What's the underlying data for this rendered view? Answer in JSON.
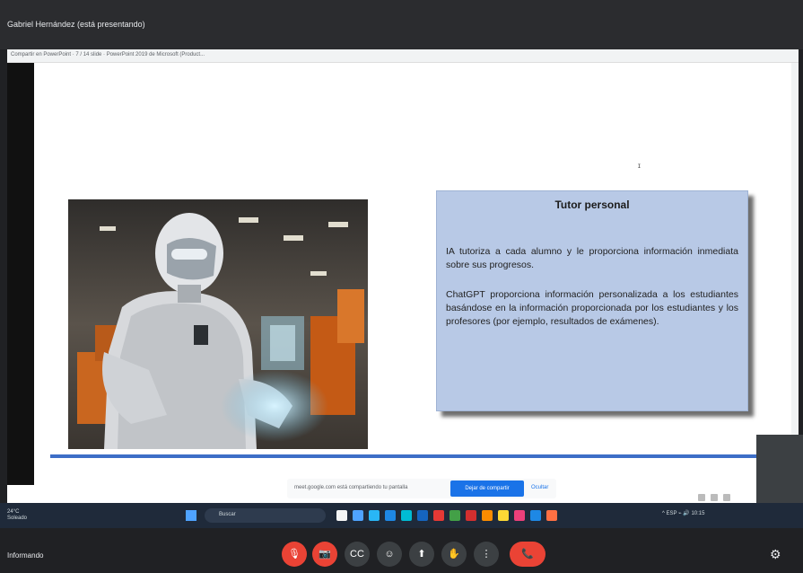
{
  "window": {
    "title": "Gabriel Hernández (está presentando)"
  },
  "browser": {
    "tab_text": "Compartir en PowerPoint · 7 / 14 slide · PowerPoint 2019 de Microsoft (Product..."
  },
  "slide": {
    "box_title": "Tutor personal",
    "paragraph_1": "IA tutoriza a cada alumno y le proporciona información inmediata sobre sus progresos.",
    "paragraph_2": "ChatGPT proporciona información personalizada a los estudiantes basándose en la información proporcionada por los estudiantes y los profesores (por ejemplo, resultados de exámenes).",
    "cursor_glyph": "ɪ"
  },
  "share_bar": {
    "message": "meet.google.com está compartiendo tu pantalla",
    "stop_label": "Dejar de compartir",
    "hide_label": "Ocultar"
  },
  "taskbar": {
    "weather_temp": "24°C",
    "weather_desc": "Soleado",
    "search_label": "Buscar",
    "app_colors": [
      "#f5f5f5",
      "#4fa3ff",
      "#29b6f6",
      "#1e88e5",
      "#00bcd4",
      "#1565c0",
      "#e53935",
      "#43a047",
      "#d32f2f",
      "#fb8c00",
      "#fdd835",
      "#ec407a",
      "#1e88e5",
      "#ff7043"
    ],
    "tray_text": "^  ESP  ⌁  🔊  10:15"
  },
  "call_bar": {
    "meeting_name": "Informando",
    "mic_icon": "🎙",
    "cam_icon": "📷",
    "cc_icon": "CC",
    "emoji_icon": "☺",
    "present_icon": "⬆",
    "raise_icon": "✋",
    "more_icon": "⋮",
    "end_icon": "📞",
    "settings_icon": "⚙"
  },
  "colors": {
    "accent": "#1a73e8",
    "danger": "#ea4335",
    "slide_box": "#b8c9e6",
    "slide_line": "#3d6ec7"
  }
}
